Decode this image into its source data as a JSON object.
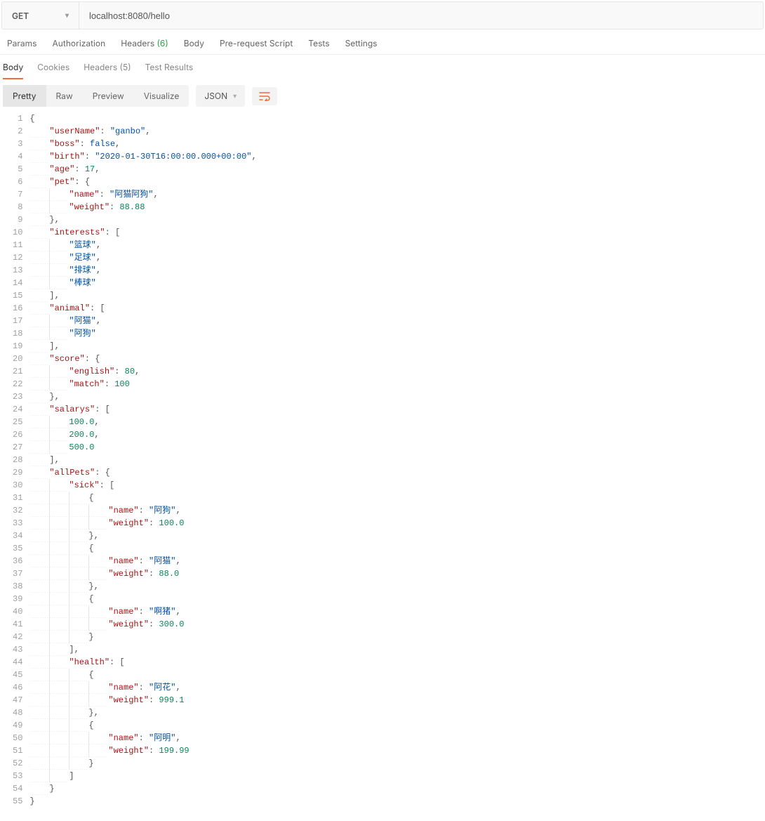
{
  "request": {
    "method": "GET",
    "url": "localhost:8080/hello"
  },
  "request_tabs": {
    "params": "Params",
    "authorization": "Authorization",
    "headers_label": "Headers",
    "headers_count": "(6)",
    "body": "Body",
    "prerequest": "Pre-request Script",
    "tests": "Tests",
    "settings": "Settings"
  },
  "response_tabs": {
    "body": "Body",
    "cookies": "Cookies",
    "headers_label": "Headers",
    "headers_count": "(5)",
    "test_results": "Test Results"
  },
  "view_modes": {
    "pretty": "Pretty",
    "raw": "Raw",
    "preview": "Preview",
    "visualize": "Visualize"
  },
  "language_select": "JSON",
  "response_json": {
    "userName": "ganbo",
    "boss": false,
    "birth": "2020-01-30T16:00:00.000+00:00",
    "age": 17,
    "pet": {
      "name": "阿猫阿狗",
      "weight": 88.88
    },
    "interests": [
      "篮球",
      "足球",
      "排球",
      "棒球"
    ],
    "animal": [
      "阿猫",
      "阿狗"
    ],
    "score": {
      "english": 80,
      "match": 100
    },
    "salarys": [
      100.0,
      200.0,
      500.0
    ],
    "allPets": {
      "sick": [
        {
          "name": "阿狗",
          "weight": 100.0
        },
        {
          "name": "阿猫",
          "weight": 88.0
        },
        {
          "name": "啊猪",
          "weight": 300.0
        }
      ],
      "health": [
        {
          "name": "阿花",
          "weight": 999.1
        },
        {
          "name": "阿明",
          "weight": 199.99
        }
      ]
    }
  },
  "code_lines": [
    [
      [
        0,
        "pun",
        "{"
      ]
    ],
    [
      [
        1,
        "key",
        "userName"
      ],
      [
        0,
        "pun",
        ": "
      ],
      [
        0,
        "str",
        "ganbo"
      ],
      [
        0,
        "pun",
        ","
      ]
    ],
    [
      [
        1,
        "key",
        "boss"
      ],
      [
        0,
        "pun",
        ": "
      ],
      [
        0,
        "bool",
        "false"
      ],
      [
        0,
        "pun",
        ","
      ]
    ],
    [
      [
        1,
        "key",
        "birth"
      ],
      [
        0,
        "pun",
        ": "
      ],
      [
        0,
        "str",
        "2020-01-30T16:00:00.000+00:00"
      ],
      [
        0,
        "pun",
        ","
      ]
    ],
    [
      [
        1,
        "key",
        "age"
      ],
      [
        0,
        "pun",
        ": "
      ],
      [
        0,
        "num",
        "17"
      ],
      [
        0,
        "pun",
        ","
      ]
    ],
    [
      [
        1,
        "key",
        "pet"
      ],
      [
        0,
        "pun",
        ": {"
      ]
    ],
    [
      [
        2,
        "key",
        "name"
      ],
      [
        0,
        "pun",
        ": "
      ],
      [
        0,
        "str",
        "阿猫阿狗"
      ],
      [
        0,
        "pun",
        ","
      ]
    ],
    [
      [
        2,
        "key",
        "weight"
      ],
      [
        0,
        "pun",
        ": "
      ],
      [
        0,
        "num",
        "88.88"
      ]
    ],
    [
      [
        1,
        "pun",
        "},"
      ]
    ],
    [
      [
        1,
        "key",
        "interests"
      ],
      [
        0,
        "pun",
        ": ["
      ]
    ],
    [
      [
        2,
        "str",
        "篮球"
      ],
      [
        0,
        "pun",
        ","
      ]
    ],
    [
      [
        2,
        "str",
        "足球"
      ],
      [
        0,
        "pun",
        ","
      ]
    ],
    [
      [
        2,
        "str",
        "排球"
      ],
      [
        0,
        "pun",
        ","
      ]
    ],
    [
      [
        2,
        "str",
        "棒球"
      ]
    ],
    [
      [
        1,
        "pun",
        "],"
      ]
    ],
    [
      [
        1,
        "key",
        "animal"
      ],
      [
        0,
        "pun",
        ": ["
      ]
    ],
    [
      [
        2,
        "str",
        "阿猫"
      ],
      [
        0,
        "pun",
        ","
      ]
    ],
    [
      [
        2,
        "str",
        "阿狗"
      ]
    ],
    [
      [
        1,
        "pun",
        "],"
      ]
    ],
    [
      [
        1,
        "key",
        "score"
      ],
      [
        0,
        "pun",
        ": {"
      ]
    ],
    [
      [
        2,
        "key",
        "english"
      ],
      [
        0,
        "pun",
        ": "
      ],
      [
        0,
        "num",
        "80"
      ],
      [
        0,
        "pun",
        ","
      ]
    ],
    [
      [
        2,
        "key",
        "match"
      ],
      [
        0,
        "pun",
        ": "
      ],
      [
        0,
        "num",
        "100"
      ]
    ],
    [
      [
        1,
        "pun",
        "},"
      ]
    ],
    [
      [
        1,
        "key",
        "salarys"
      ],
      [
        0,
        "pun",
        ": ["
      ]
    ],
    [
      [
        2,
        "num",
        "100.0"
      ],
      [
        0,
        "pun",
        ","
      ]
    ],
    [
      [
        2,
        "num",
        "200.0"
      ],
      [
        0,
        "pun",
        ","
      ]
    ],
    [
      [
        2,
        "num",
        "500.0"
      ]
    ],
    [
      [
        1,
        "pun",
        "],"
      ]
    ],
    [
      [
        1,
        "key",
        "allPets"
      ],
      [
        0,
        "pun",
        ": {"
      ]
    ],
    [
      [
        2,
        "key",
        "sick"
      ],
      [
        0,
        "pun",
        ": ["
      ]
    ],
    [
      [
        3,
        "pun",
        "{"
      ]
    ],
    [
      [
        4,
        "key",
        "name"
      ],
      [
        0,
        "pun",
        ": "
      ],
      [
        0,
        "str",
        "阿狗"
      ],
      [
        0,
        "pun",
        ","
      ]
    ],
    [
      [
        4,
        "key",
        "weight"
      ],
      [
        0,
        "pun",
        ": "
      ],
      [
        0,
        "num",
        "100.0"
      ]
    ],
    [
      [
        3,
        "pun",
        "},"
      ]
    ],
    [
      [
        3,
        "pun",
        "{"
      ]
    ],
    [
      [
        4,
        "key",
        "name"
      ],
      [
        0,
        "pun",
        ": "
      ],
      [
        0,
        "str",
        "阿猫"
      ],
      [
        0,
        "pun",
        ","
      ]
    ],
    [
      [
        4,
        "key",
        "weight"
      ],
      [
        0,
        "pun",
        ": "
      ],
      [
        0,
        "num",
        "88.0"
      ]
    ],
    [
      [
        3,
        "pun",
        "},"
      ]
    ],
    [
      [
        3,
        "pun",
        "{"
      ]
    ],
    [
      [
        4,
        "key",
        "name"
      ],
      [
        0,
        "pun",
        ": "
      ],
      [
        0,
        "str",
        "啊猪"
      ],
      [
        0,
        "pun",
        ","
      ]
    ],
    [
      [
        4,
        "key",
        "weight"
      ],
      [
        0,
        "pun",
        ": "
      ],
      [
        0,
        "num",
        "300.0"
      ]
    ],
    [
      [
        3,
        "pun",
        "}"
      ]
    ],
    [
      [
        2,
        "pun",
        "],"
      ]
    ],
    [
      [
        2,
        "key",
        "health"
      ],
      [
        0,
        "pun",
        ": ["
      ]
    ],
    [
      [
        3,
        "pun",
        "{"
      ]
    ],
    [
      [
        4,
        "key",
        "name"
      ],
      [
        0,
        "pun",
        ": "
      ],
      [
        0,
        "str",
        "阿花"
      ],
      [
        0,
        "pun",
        ","
      ]
    ],
    [
      [
        4,
        "key",
        "weight"
      ],
      [
        0,
        "pun",
        ": "
      ],
      [
        0,
        "num",
        "999.1"
      ]
    ],
    [
      [
        3,
        "pun",
        "},"
      ]
    ],
    [
      [
        3,
        "pun",
        "{"
      ]
    ],
    [
      [
        4,
        "key",
        "name"
      ],
      [
        0,
        "pun",
        ": "
      ],
      [
        0,
        "str",
        "阿明"
      ],
      [
        0,
        "pun",
        ","
      ]
    ],
    [
      [
        4,
        "key",
        "weight"
      ],
      [
        0,
        "pun",
        ": "
      ],
      [
        0,
        "num",
        "199.99"
      ]
    ],
    [
      [
        3,
        "pun",
        "}"
      ]
    ],
    [
      [
        2,
        "pun",
        "]"
      ]
    ],
    [
      [
        1,
        "pun",
        "}"
      ]
    ],
    [
      [
        0,
        "pun",
        "}"
      ]
    ]
  ]
}
